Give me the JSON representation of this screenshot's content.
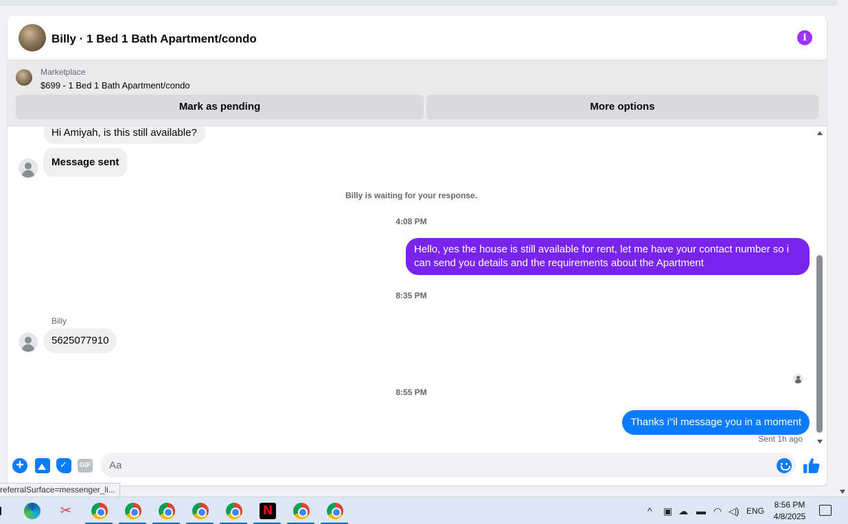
{
  "header": {
    "title": "Billy · 1 Bed 1 Bath Apartment/condo",
    "info_icon": "info-icon",
    "accent": "#a033ff"
  },
  "marketplace": {
    "label": "Marketplace",
    "listing": "$699 - 1 Bed 1 Bath Apartment/condo",
    "mark_pending_label": "Mark as pending",
    "more_options_label": "More options"
  },
  "messages": {
    "first_in": "Hi Amiyah, is this still available?",
    "message_sent": "Message sent",
    "waiting_notice": "Billy is waiting for your response.",
    "time_1": "4:08 PM",
    "out_1": "Hello, yes the house is still available for rent, let me have your contact number so i can send you details and the requirements about the  Apartment",
    "time_2": "8:35 PM",
    "sender_name": "Billy",
    "in_number": "5625077910",
    "time_3": "8:55 PM",
    "out_2": "Thanks i\"il message you in a moment",
    "sent_status": "Sent 1h ago",
    "colors": {
      "outgoing_purple": "#7a24f0",
      "outgoing_blue": "#0a7cff",
      "incoming": "#f0f0f0"
    }
  },
  "composer": {
    "placeholder": "Aa",
    "gif_label": "GIF",
    "icons": [
      "plus-icon",
      "photo-icon",
      "sticker-icon",
      "gif-icon",
      "emoji-icon",
      "thumbs-up-icon"
    ]
  },
  "statusbar": {
    "url_fragment": "referralSurface=messenger_li..."
  },
  "taskbar": {
    "apps": [
      "edge",
      "snipping-tool",
      "chrome",
      "chrome",
      "chrome",
      "chrome",
      "chrome",
      "netflix",
      "chrome",
      "chrome"
    ],
    "netflix_glyph": "N",
    "tray_language": "ENG",
    "time": "8:56 PM",
    "date": "4/8/2025"
  }
}
